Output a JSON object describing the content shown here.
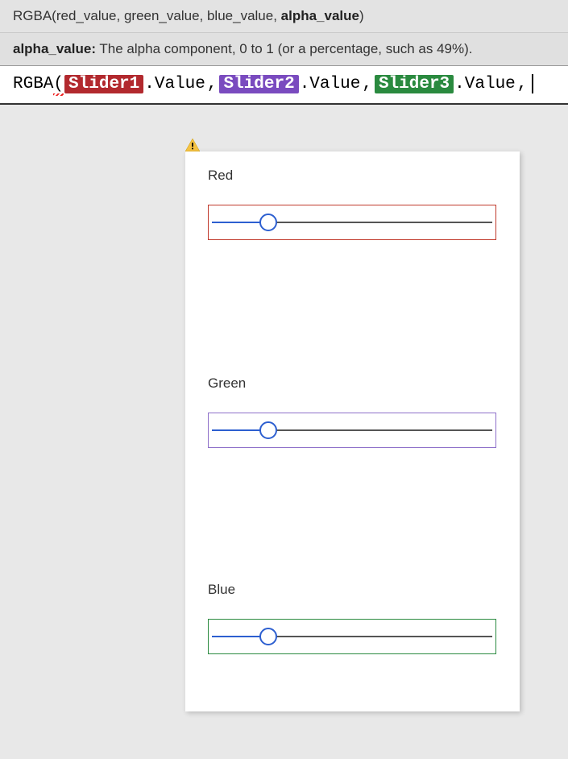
{
  "tooltip": {
    "signature_prefix": "RGBA(red_value, green_value, blue_value, ",
    "signature_bold": "alpha_value",
    "signature_suffix": ")",
    "param_name": "alpha_value:",
    "param_desc": " The alpha component, 0 to 1 (or a percentage, such as 49%)."
  },
  "formula": {
    "fn": "RGBA",
    "open": "( ",
    "slider1": "Slider1",
    "slider2": "Slider2",
    "slider3": "Slider3",
    "value": ".Value",
    "comma": ", "
  },
  "card": {
    "sliders": [
      {
        "label": "Red",
        "border_class": "red-border",
        "value": 20
      },
      {
        "label": "Green",
        "border_class": "purple-border",
        "value": 20
      },
      {
        "label": "Blue",
        "border_class": "green-border",
        "value": 20
      }
    ]
  },
  "colors": {
    "chip_red": "#b2292e",
    "chip_purple": "#7a4bbf",
    "chip_green": "#2a8a3f"
  }
}
